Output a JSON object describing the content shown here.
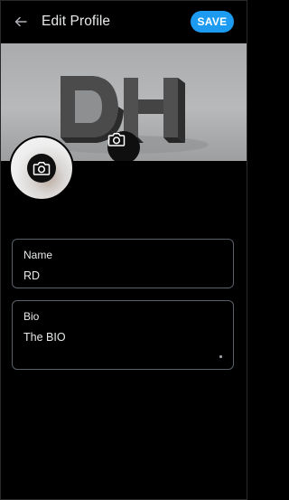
{
  "header": {
    "title": "Edit Profile",
    "save_label": "SAVE",
    "back_icon": "arrow-left-icon"
  },
  "banner": {
    "image_description": "grey 3D DH logo",
    "logo_text": "DH",
    "camera_icon": "camera-icon"
  },
  "avatar": {
    "camera_icon": "camera-icon"
  },
  "form": {
    "name": {
      "label": "Name",
      "value": "RD"
    },
    "bio": {
      "label": "Bio",
      "value": "The BIO"
    }
  },
  "colors": {
    "accent": "#1d9bf0",
    "background": "#000000",
    "field_border": "#5b6168",
    "text": "#e7e9ea"
  }
}
